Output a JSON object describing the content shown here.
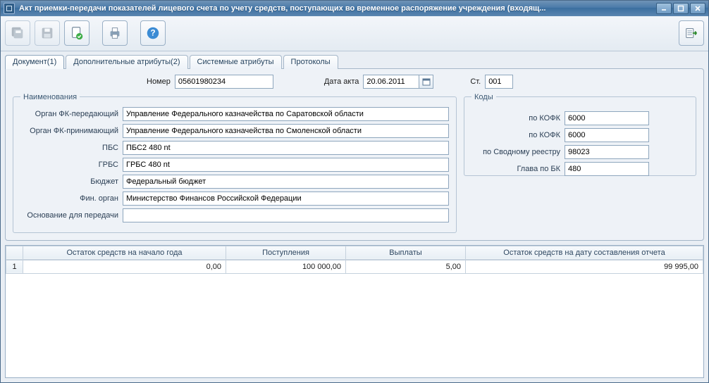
{
  "window": {
    "title": "Акт приемки-передачи показателей лицевого счета по учету средств, поступающих во временное распоряжение учреждения (входящ..."
  },
  "tabs": {
    "t0": "Документ(1)",
    "t1": "Дополнительные атрибуты(2)",
    "t2": "Системные атрибуты",
    "t3": "Протоколы"
  },
  "header": {
    "number_label": "Номер",
    "number_value": "05601980234",
    "date_label": "Дата акта",
    "date_value": "20.06.2011",
    "st_label": "Ст.",
    "st_value": "001"
  },
  "names_group": {
    "legend": "Наименования",
    "rows": {
      "org_fk_send_label": "Орган ФК-передающий",
      "org_fk_send_value": "Управление Федерального казначейства по Саратовской области",
      "org_fk_recv_label": "Орган ФК-принимающий",
      "org_fk_recv_value": "Управление Федерального казначейства по Смоленской области",
      "pbs_label": "ПБС",
      "pbs_value": "ПБС2 480 nt",
      "grbs_label": "ГРБС",
      "grbs_value": "ГРБС 480 nt",
      "budget_label": "Бюджет",
      "budget_value": "Федеральный бюджет",
      "fin_label": "Фин. орган",
      "fin_value": "Министерство Финансов Российской Федерации",
      "reason_label": "Основание для передачи",
      "reason_value": ""
    }
  },
  "codes_group": {
    "legend": "Коды",
    "rows": {
      "kofk1_label": "по КОФК",
      "kofk1_value": "6000",
      "kofk2_label": "по КОФК",
      "kofk2_value": "6000",
      "svod_label": "по Сводному реестру",
      "svod_value": "98023",
      "glava_label": "Глава по БК",
      "glava_value": "480"
    }
  },
  "grid": {
    "headers": {
      "h1": "Остаток средств на начало года",
      "h2": "Поступления",
      "h3": "Выплаты",
      "h4": "Остаток средств на дату составления отчета"
    },
    "row1": {
      "num": "1",
      "c1": "0,00",
      "c2": "100 000,00",
      "c3": "5,00",
      "c4": "99 995,00"
    }
  }
}
